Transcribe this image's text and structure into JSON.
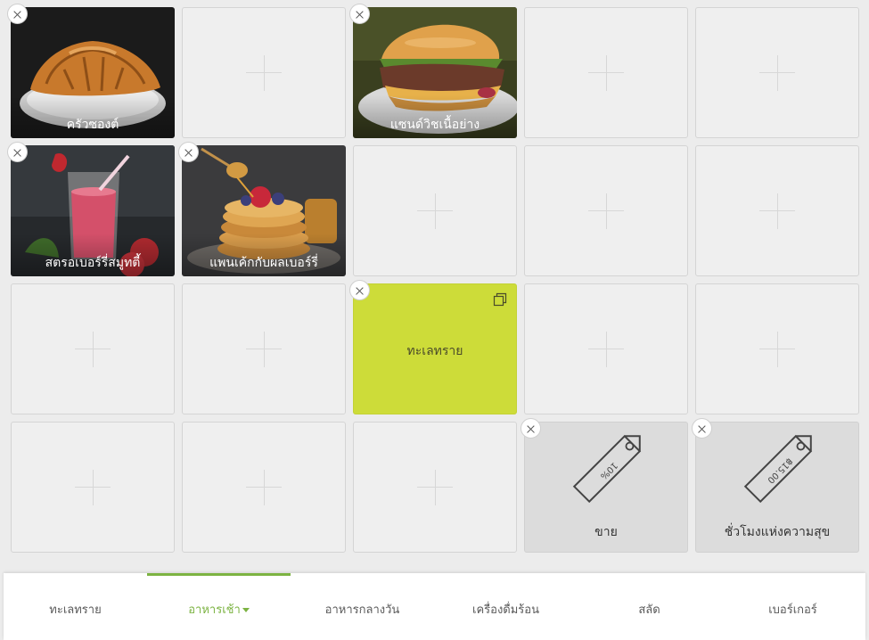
{
  "menu_items": {
    "croissant": "ครัวซองต์",
    "sandwich": "แซนด์วิชเนื้อย่าง",
    "smoothie": "สตรอเบอร์รี่สมูทตี้",
    "pancake": "แพนเค้กกับผลเบอร์รี่"
  },
  "group_tile": {
    "label": "ทะเลทราย",
    "color": "#cddc39"
  },
  "discounts": [
    {
      "label": "ขาย",
      "tag_text": "10%"
    },
    {
      "label": "ชั่วโมงแห่งความสุข",
      "tag_text": "฿15.00"
    }
  ],
  "tabs": [
    {
      "label": "ทะเลทราย"
    },
    {
      "label": "อาหารเช้า",
      "active": true
    },
    {
      "label": "อาหารกลางวัน"
    },
    {
      "label": "เครื่องดื่มร้อน"
    },
    {
      "label": "สลัด"
    },
    {
      "label": "เบอร์เกอร์"
    }
  ],
  "colors": {
    "accent": "#7cb342",
    "group_tile": "#cddc39",
    "empty_tile": "#efefef",
    "discount_tile": "#dcdcdc"
  }
}
